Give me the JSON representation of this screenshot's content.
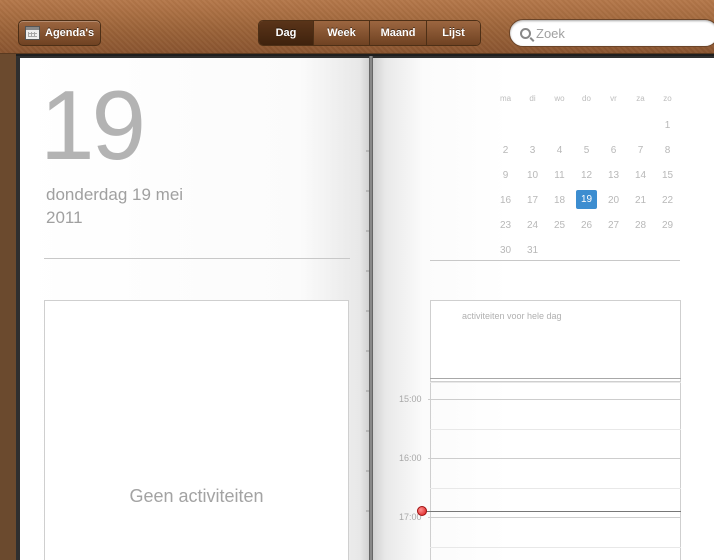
{
  "toolbar": {
    "calendars_label": "Agenda's",
    "views": [
      {
        "label": "Dag",
        "active": true
      },
      {
        "label": "Week",
        "active": false
      },
      {
        "label": "Maand",
        "active": false
      },
      {
        "label": "Lijst",
        "active": false
      }
    ],
    "search_placeholder": "Zoek"
  },
  "day_page": {
    "day_number": "19",
    "weekday_date": "donderdag 19 mei",
    "year": "2011",
    "no_events_text": "Geen activiteiten"
  },
  "mini_calendar": {
    "weekdays": [
      "ma",
      "di",
      "wo",
      "do",
      "vr",
      "za",
      "zo"
    ],
    "weeks": [
      [
        "",
        "",
        "",
        "",
        "",
        "",
        "1"
      ],
      [
        "2",
        "3",
        "4",
        "5",
        "6",
        "7",
        "8"
      ],
      [
        "9",
        "10",
        "11",
        "12",
        "13",
        "14",
        "15"
      ],
      [
        "16",
        "17",
        "18",
        "19",
        "20",
        "21",
        "22"
      ],
      [
        "23",
        "24",
        "25",
        "26",
        "27",
        "28",
        "29"
      ],
      [
        "30",
        "31",
        "",
        "",
        "",
        "",
        ""
      ]
    ],
    "selected_day": "19",
    "selected_color": "#3c8dd0"
  },
  "timeline": {
    "all_day_label": "activiteiten voor hele dag",
    "hours": [
      "15:00",
      "16:00",
      "17:00"
    ],
    "current_time_color": "#d81818"
  }
}
